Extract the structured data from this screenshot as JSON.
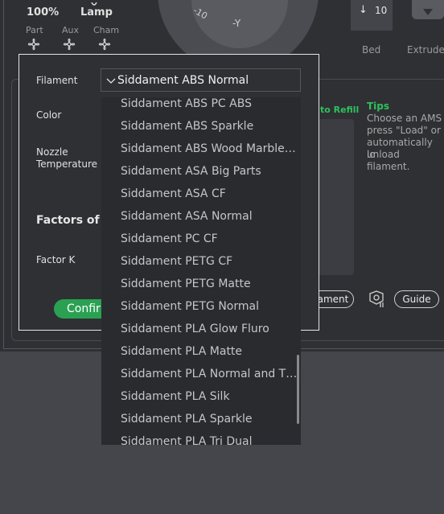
{
  "top": {
    "speed_value": "100%",
    "lamp_label": "Lamp",
    "fans": [
      {
        "label": "Part"
      },
      {
        "label": "Aux"
      },
      {
        "label": "Cham"
      }
    ],
    "jog_label_10": "-10",
    "jog_label_y": "-Y",
    "bed_value": "10",
    "bed_label": "Bed",
    "extruder_label": "Extrude"
  },
  "background_panel": {
    "auto_refill": "to Refill",
    "tips_title": "Tips",
    "tips_lines": [
      "Choose an AMS",
      "press \"Load\" or",
      "automatically lo",
      "unload filament."
    ],
    "filament_button": "ament",
    "guide_button": "Guide",
    "paren": ")"
  },
  "dialog": {
    "filament_label": "Filament",
    "filament_selected": "Siddament ABS Normal",
    "color_label": "Color",
    "nozzle_label_line1": "Nozzle",
    "nozzle_label_line2": "Temperature",
    "factors_label": "Factors of F",
    "factor_k_label": "Factor K",
    "confirm_label": "Confir"
  },
  "dropdown": {
    "items": [
      "Siddament ABS PC ABS",
      "Siddament ABS Sparkle",
      "Siddament ABS Wood Marble…",
      "Siddament ASA Big Parts",
      "Siddament ASA CF",
      "Siddament ASA Normal",
      "Siddament PC CF",
      "Siddament PETG CF",
      "Siddament PETG Matte",
      "Siddament PETG Normal",
      "Siddament PLA Glow Fluro",
      "Siddament PLA Matte",
      "Siddament PLA Normal and T…",
      "Siddament PLA Silk",
      "Siddament PLA Sparkle",
      "Siddament PLA Tri Dual"
    ]
  },
  "colors": {
    "accent_green": "#2aa152",
    "tips_green": "#2ec05c",
    "background": "#45464b",
    "panel": "#2f3034"
  }
}
